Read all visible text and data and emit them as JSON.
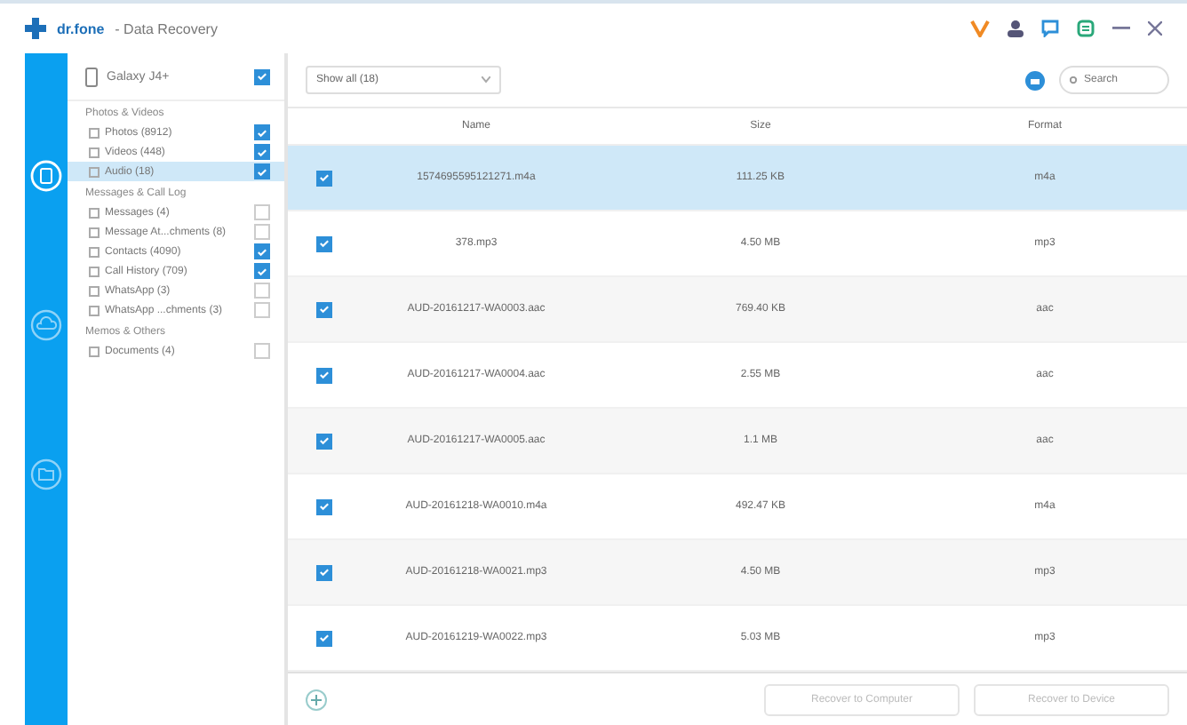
{
  "window": {
    "app_name": "dr.fone",
    "title": "- Data Recovery"
  },
  "device": {
    "name": "Galaxy J4+",
    "checked": true
  },
  "sidebar": {
    "groups": [
      {
        "label": "Photos & Videos",
        "items": [
          {
            "label": "Photos (8912)",
            "checked": true,
            "selected": false
          },
          {
            "label": "Videos (448)",
            "checked": true,
            "selected": false
          },
          {
            "label": "Audio (18)",
            "checked": true,
            "selected": true
          }
        ]
      },
      {
        "label": "Messages & Call Log",
        "items": [
          {
            "label": "Messages (4)",
            "checked": false,
            "selected": false
          },
          {
            "label": "Message At...chments (8)",
            "checked": false,
            "selected": false
          },
          {
            "label": "Contacts (4090)",
            "checked": true,
            "selected": false
          },
          {
            "label": "Call History (709)",
            "checked": true,
            "selected": false
          },
          {
            "label": "WhatsApp (3)",
            "checked": false,
            "selected": false
          },
          {
            "label": "WhatsApp ...chments (3)",
            "checked": false,
            "selected": false
          }
        ]
      },
      {
        "label": "Memos & Others",
        "items": [
          {
            "label": "Documents (4)",
            "checked": false,
            "selected": false
          }
        ]
      }
    ]
  },
  "filter": {
    "value": "Show all (18)"
  },
  "search": {
    "placeholder": "Search"
  },
  "table": {
    "columns": [
      "Name",
      "Size",
      "Format"
    ],
    "rows": [
      {
        "cells": [
          "1574695595121271.m4a",
          "111.25 KB",
          "m4a"
        ],
        "checked": true,
        "selected": true
      },
      {
        "cells": [
          "378.mp3",
          "4.50 MB",
          "mp3"
        ],
        "checked": true,
        "selected": false
      },
      {
        "cells": [
          "AUD-20161217-WA0003.aac",
          "769.40 KB",
          "aac"
        ],
        "checked": true,
        "selected": false
      },
      {
        "cells": [
          "AUD-20161217-WA0004.aac",
          "2.55 MB",
          "aac"
        ],
        "checked": true,
        "selected": false
      },
      {
        "cells": [
          "AUD-20161217-WA0005.aac",
          "1.1 MB",
          "aac"
        ],
        "checked": true,
        "selected": false
      },
      {
        "cells": [
          "AUD-20161218-WA0010.m4a",
          "492.47 KB",
          "m4a"
        ],
        "checked": true,
        "selected": false
      },
      {
        "cells": [
          "AUD-20161218-WA0021.mp3",
          "4.50 MB",
          "mp3"
        ],
        "checked": true,
        "selected": false
      },
      {
        "cells": [
          "AUD-20161219-WA0022.mp3",
          "5.03 MB",
          "mp3"
        ],
        "checked": true,
        "selected": false
      }
    ]
  },
  "buttons": [
    "Recover to Computer",
    "Recover to Device"
  ]
}
